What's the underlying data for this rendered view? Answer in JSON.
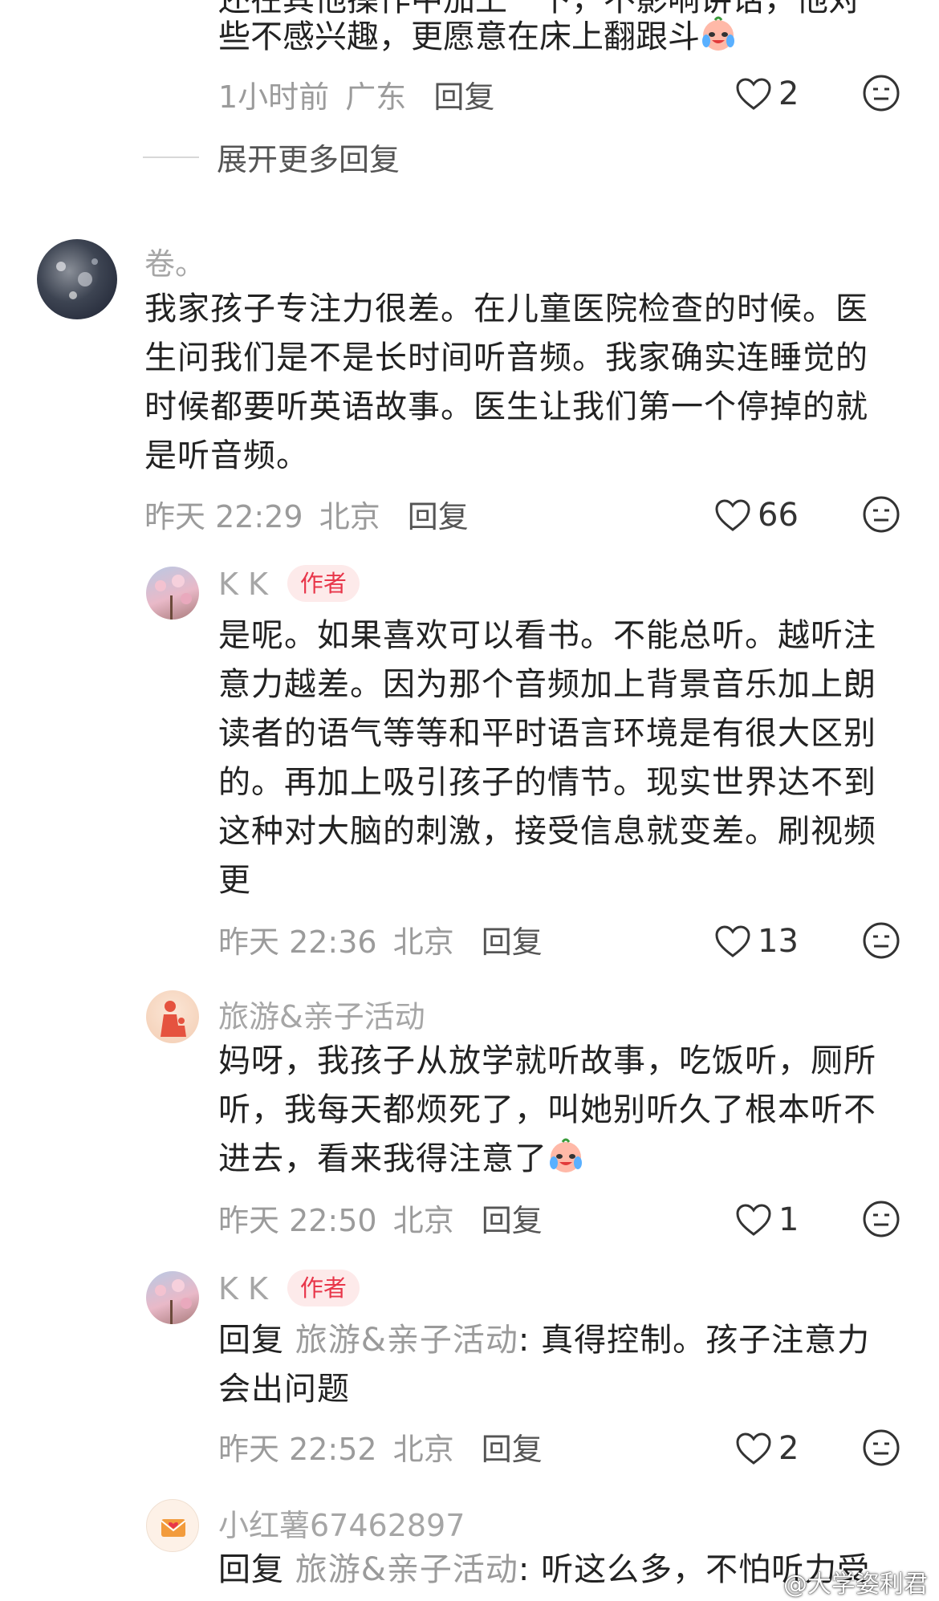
{
  "top_fragment": {
    "cut_line": "还在其他操作中加上一下，不影响讲话，他对",
    "text": "些不感兴趣，更愿意在床上翻跟斗",
    "emoji_icon": "crying-laughing-emoji",
    "time": "1小时前",
    "location": "广东",
    "reply_label": "回复",
    "likes": "2",
    "expand_label": "展开更多回复"
  },
  "comments": [
    {
      "author": "卷。",
      "lines": [
        "我家孩子专注力很差。在儿童医院检查的时候。医",
        "生问我们是不是长时间听音频。我家确实连睡觉的",
        "时候都要听英语故事。医生让我们第一个停掉的就",
        "是听音频。"
      ],
      "time": "昨天 22:29",
      "location": "北京",
      "reply_label": "回复",
      "likes": "66"
    },
    {
      "author": "K K",
      "badge": "作者",
      "lines": [
        "是呢。如果喜欢可以看书。不能总听。越听注",
        "意力越差。因为那个音频加上背景音乐加上朗",
        "读者的语气等等和平时语言环境是有很大区别",
        "的。再加上吸引孩子的情节。现实世界达不到",
        "这种对大脑的刺激，接受信息就变差。刷视频",
        "更"
      ],
      "time": "昨天 22:36",
      "location": "北京",
      "reply_label": "回复",
      "likes": "13"
    },
    {
      "author": "旅游&亲子活动",
      "lines": [
        "妈呀，我孩子从放学就听故事，吃饭听，厕所",
        "听，我每天都烦死了，叫她别听久了根本听不",
        "进去，看来我得注意了"
      ],
      "time": "昨天 22:50",
      "location": "北京",
      "reply_label": "回复",
      "likes": "1"
    },
    {
      "author": "K K",
      "badge": "作者",
      "reply_prefix": "回复",
      "reply_to": "旅游&亲子活动",
      "lines": [
        ": 真得控制。孩子注意力",
        "会出问题"
      ],
      "time": "昨天 22:52",
      "location": "北京",
      "reply_label": "回复",
      "likes": "2"
    },
    {
      "author": "小红薯67462897",
      "reply_prefix": "回复",
      "reply_to": "旅游&亲子活动",
      "lines": [
        ": 听这么多，不怕听力受"
      ]
    }
  ],
  "watermark": "@大学姿利君",
  "colors": {
    "badge_bg": "#fdeaea",
    "badge_text": "#e8364a",
    "meta": "#9b9b9b"
  }
}
